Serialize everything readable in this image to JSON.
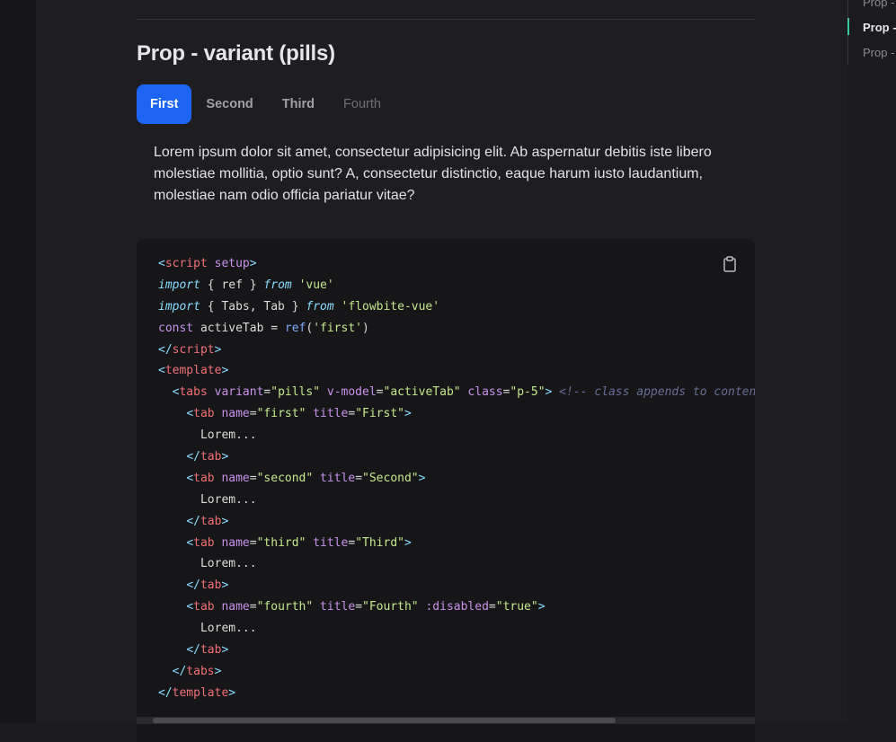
{
  "section": {
    "title": "Prop - variant (pills)"
  },
  "tabs": [
    {
      "label": "First",
      "state": "active"
    },
    {
      "label": "Second",
      "state": "default"
    },
    {
      "label": "Third",
      "state": "default"
    },
    {
      "label": "Fourth",
      "state": "disabled"
    }
  ],
  "content": {
    "text": "Lorem ipsum dolor sit amet, consectetur adipisicing elit. Ab aspernatur debitis iste libero molestiae mollitia, optio sunt? A, consectetur distinctio, eaque harum iusto laudantium, molestiae nam odio officia pariatur vitae?"
  },
  "code": {
    "copy_icon": "clipboard-icon",
    "lines": [
      [
        {
          "t": "<",
          "c": "punct"
        },
        {
          "t": "script",
          "c": "tag"
        },
        {
          "t": " setup",
          "c": "attr"
        },
        {
          "t": ">",
          "c": "punct"
        }
      ],
      [
        {
          "t": "import",
          "c": "kw"
        },
        {
          "t": " { ref } ",
          "c": "plain"
        },
        {
          "t": "from",
          "c": "kw"
        },
        {
          "t": " ",
          "c": "plain"
        },
        {
          "t": "'vue'",
          "c": "str"
        }
      ],
      [
        {
          "t": "import",
          "c": "kw"
        },
        {
          "t": " { Tabs, Tab } ",
          "c": "plain"
        },
        {
          "t": "from",
          "c": "kw"
        },
        {
          "t": " ",
          "c": "plain"
        },
        {
          "t": "'flowbite-vue'",
          "c": "str"
        }
      ],
      [
        {
          "t": "const",
          "c": "attr"
        },
        {
          "t": " activeTab = ",
          "c": "plain"
        },
        {
          "t": "ref",
          "c": "fn"
        },
        {
          "t": "(",
          "c": "plain"
        },
        {
          "t": "'first'",
          "c": "str"
        },
        {
          "t": ")",
          "c": "plain"
        }
      ],
      [
        {
          "t": "</",
          "c": "punct"
        },
        {
          "t": "script",
          "c": "tag"
        },
        {
          "t": ">",
          "c": "punct"
        }
      ],
      [
        {
          "t": "<",
          "c": "punct"
        },
        {
          "t": "template",
          "c": "tag"
        },
        {
          "t": ">",
          "c": "punct"
        }
      ],
      [
        {
          "t": "  ",
          "c": "plain"
        },
        {
          "t": "<",
          "c": "punct"
        },
        {
          "t": "tabs",
          "c": "tag"
        },
        {
          "t": " variant",
          "c": "attr"
        },
        {
          "t": "=",
          "c": "plain"
        },
        {
          "t": "\"pills\"",
          "c": "str"
        },
        {
          "t": " v-model",
          "c": "attr"
        },
        {
          "t": "=",
          "c": "plain"
        },
        {
          "t": "\"activeTab\"",
          "c": "str"
        },
        {
          "t": " class",
          "c": "attr"
        },
        {
          "t": "=",
          "c": "plain"
        },
        {
          "t": "\"p-5\"",
          "c": "str"
        },
        {
          "t": ">",
          "c": "punct"
        },
        {
          "t": " <!-- class appends to content DIV",
          "c": "comment"
        }
      ],
      [
        {
          "t": "    ",
          "c": "plain"
        },
        {
          "t": "<",
          "c": "punct"
        },
        {
          "t": "tab",
          "c": "tag"
        },
        {
          "t": " name",
          "c": "attr"
        },
        {
          "t": "=",
          "c": "plain"
        },
        {
          "t": "\"first\"",
          "c": "str"
        },
        {
          "t": " title",
          "c": "attr"
        },
        {
          "t": "=",
          "c": "plain"
        },
        {
          "t": "\"First\"",
          "c": "str"
        },
        {
          "t": ">",
          "c": "punct"
        }
      ],
      [
        {
          "t": "      Lorem...",
          "c": "plain"
        }
      ],
      [
        {
          "t": "    ",
          "c": "plain"
        },
        {
          "t": "</",
          "c": "punct"
        },
        {
          "t": "tab",
          "c": "tag"
        },
        {
          "t": ">",
          "c": "punct"
        }
      ],
      [
        {
          "t": "    ",
          "c": "plain"
        },
        {
          "t": "<",
          "c": "punct"
        },
        {
          "t": "tab",
          "c": "tag"
        },
        {
          "t": " name",
          "c": "attr"
        },
        {
          "t": "=",
          "c": "plain"
        },
        {
          "t": "\"second\"",
          "c": "str"
        },
        {
          "t": " title",
          "c": "attr"
        },
        {
          "t": "=",
          "c": "plain"
        },
        {
          "t": "\"Second\"",
          "c": "str"
        },
        {
          "t": ">",
          "c": "punct"
        }
      ],
      [
        {
          "t": "      Lorem...",
          "c": "plain"
        }
      ],
      [
        {
          "t": "    ",
          "c": "plain"
        },
        {
          "t": "</",
          "c": "punct"
        },
        {
          "t": "tab",
          "c": "tag"
        },
        {
          "t": ">",
          "c": "punct"
        }
      ],
      [
        {
          "t": "    ",
          "c": "plain"
        },
        {
          "t": "<",
          "c": "punct"
        },
        {
          "t": "tab",
          "c": "tag"
        },
        {
          "t": " name",
          "c": "attr"
        },
        {
          "t": "=",
          "c": "plain"
        },
        {
          "t": "\"third\"",
          "c": "str"
        },
        {
          "t": " title",
          "c": "attr"
        },
        {
          "t": "=",
          "c": "plain"
        },
        {
          "t": "\"Third\"",
          "c": "str"
        },
        {
          "t": ">",
          "c": "punct"
        }
      ],
      [
        {
          "t": "      Lorem...",
          "c": "plain"
        }
      ],
      [
        {
          "t": "    ",
          "c": "plain"
        },
        {
          "t": "</",
          "c": "punct"
        },
        {
          "t": "tab",
          "c": "tag"
        },
        {
          "t": ">",
          "c": "punct"
        }
      ],
      [
        {
          "t": "    ",
          "c": "plain"
        },
        {
          "t": "<",
          "c": "punct"
        },
        {
          "t": "tab",
          "c": "tag"
        },
        {
          "t": " name",
          "c": "attr"
        },
        {
          "t": "=",
          "c": "plain"
        },
        {
          "t": "\"fourth\"",
          "c": "str"
        },
        {
          "t": " title",
          "c": "attr"
        },
        {
          "t": "=",
          "c": "plain"
        },
        {
          "t": "\"Fourth\"",
          "c": "str"
        },
        {
          "t": " :disabled",
          "c": "attr"
        },
        {
          "t": "=",
          "c": "plain"
        },
        {
          "t": "\"true\"",
          "c": "str"
        },
        {
          "t": ">",
          "c": "punct"
        }
      ],
      [
        {
          "t": "      Lorem...",
          "c": "plain"
        }
      ],
      [
        {
          "t": "    ",
          "c": "plain"
        },
        {
          "t": "</",
          "c": "punct"
        },
        {
          "t": "tab",
          "c": "tag"
        },
        {
          "t": ">",
          "c": "punct"
        }
      ],
      [
        {
          "t": "  ",
          "c": "plain"
        },
        {
          "t": "</",
          "c": "punct"
        },
        {
          "t": "tabs",
          "c": "tag"
        },
        {
          "t": ">",
          "c": "punct"
        }
      ],
      [
        {
          "t": "</",
          "c": "punct"
        },
        {
          "t": "template",
          "c": "tag"
        },
        {
          "t": ">",
          "c": "punct"
        }
      ]
    ]
  },
  "toc": {
    "items": [
      {
        "label": "Prop - variant (underline)",
        "state": "default"
      },
      {
        "label": "Prop - variant (pills)",
        "state": "current"
      },
      {
        "label": "Prop - directive",
        "state": "default"
      }
    ]
  },
  "colors": {
    "accent": "#1c64f2",
    "toc_marker": "#3ac6a0",
    "syntax": {
      "punct": "#89ddff",
      "tag": "#f07178",
      "attr": "#c792ea",
      "str": "#c3e88d",
      "kw": "#89ddff",
      "fn": "#82aaff",
      "comment": "#676e95",
      "plain": "#dcdcdc"
    }
  }
}
